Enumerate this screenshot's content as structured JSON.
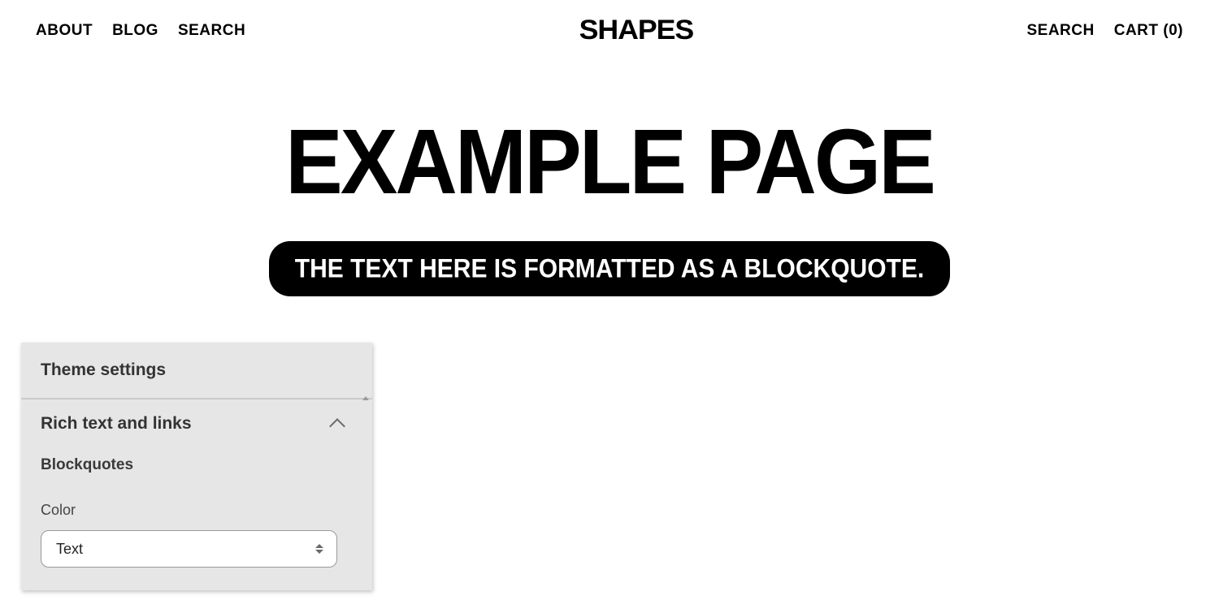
{
  "nav": {
    "left": [
      "ABOUT",
      "BLOG",
      "SEARCH"
    ],
    "logo": "SHAPES",
    "right_search": "SEARCH",
    "cart_label": "CART (0)"
  },
  "page": {
    "title": "EXAMPLE PAGE",
    "blockquote": "THE TEXT HERE IS FORMATTED AS A BLOCKQUOTE."
  },
  "panel": {
    "header": "Theme settings",
    "section_title": "Rich text and links",
    "sub_label": "Blockquotes",
    "color_label": "Color",
    "color_value": "Text"
  }
}
